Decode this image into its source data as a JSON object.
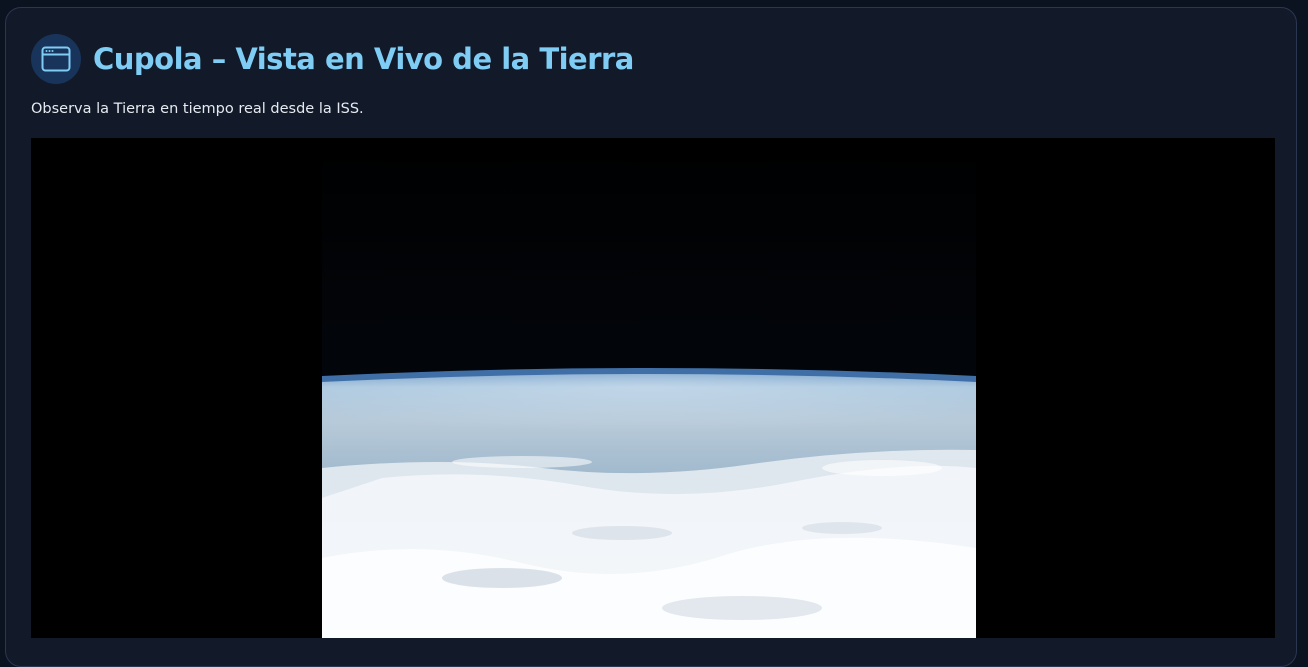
{
  "header": {
    "icon": "browser-window-icon",
    "title": "Cupola – Vista en Vivo de la Tierra"
  },
  "subtitle": "Observa la Tierra en tiempo real desde la ISS.",
  "video": {
    "content": "live-earth-feed"
  },
  "colors": {
    "background": "#0b1220",
    "panel": "#121a2a",
    "title": "#7fcdf5",
    "icon_circle": "#18345a"
  }
}
